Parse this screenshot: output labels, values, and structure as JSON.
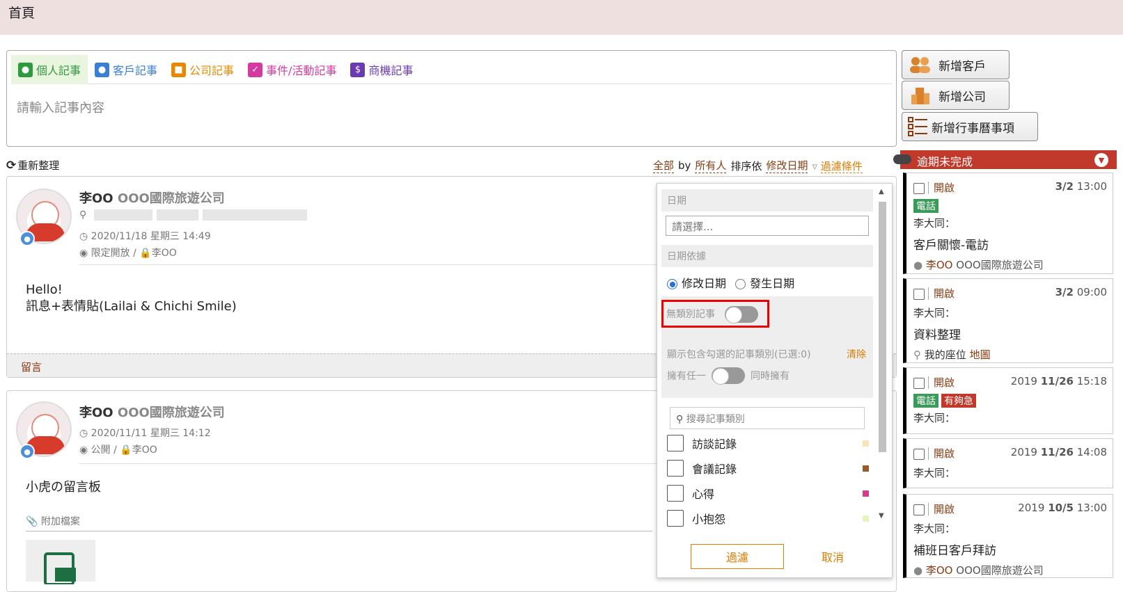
{
  "page": {
    "title": "首頁"
  },
  "composer": {
    "tabs": [
      {
        "label": "個人記事",
        "color": "#2e9a3e",
        "icon": "person-icon",
        "active": true
      },
      {
        "label": "客戶記事",
        "color": "#3a7fd5",
        "icon": "customer-icon"
      },
      {
        "label": "公司記事",
        "color": "#e58a00",
        "icon": "company-icon"
      },
      {
        "label": "事件/活動記事",
        "color": "#d63aa0",
        "icon": "calendar-icon"
      },
      {
        "label": "商機記事",
        "color": "#6a3ab0",
        "icon": "dollar-icon"
      }
    ],
    "placeholder": "請輸入記事內容"
  },
  "side_buttons": {
    "add_customer": "新增客戶",
    "add_company": "新增公司",
    "add_calendar": "新增行事曆事項"
  },
  "toolbar": {
    "refresh": "重新整理",
    "scope": "全部",
    "by": "by",
    "owner": "所有人",
    "sort_label": "排序依",
    "sort_field": "修改日期",
    "filter": "過濾條件"
  },
  "posts": [
    {
      "author": "李OO",
      "company": "OOO國際旅遊公司",
      "datetime": "2020/11/18 星期三 14:49",
      "visibility": "限定開放",
      "owner": "李OO",
      "content_line1": "Hello!",
      "content_line2": "訊息+表情貼(Lailai & Chichi Smile)",
      "comment": "留言"
    },
    {
      "author": "李OO",
      "company": "OOO國際旅遊公司",
      "datetime": "2020/11/11 星期三 14:12",
      "visibility": "公開",
      "owner": "李OO",
      "content_line1": "小虎の留言板",
      "attachment_label": "附加檔案"
    }
  ],
  "filter_panel": {
    "date_label": "日期",
    "date_placeholder": "請選擇...",
    "date_basis_label": "日期依據",
    "opt_modified": "修改日期",
    "opt_occurred": "發生日期",
    "no_category_label": "無類別記事",
    "include_label": "顯示包含勾選的記事類別(已選:0)",
    "clear": "清除",
    "any_label": "擁有任一",
    "all_label": "同時擁有",
    "search_placeholder": "搜尋記事類別",
    "categories": [
      {
        "label": "訪談記錄",
        "color": "#fbe5b8"
      },
      {
        "label": "會議記錄",
        "color": "#9a5a2a"
      },
      {
        "label": "心得",
        "color": "#d63a8a"
      },
      {
        "label": "小抱怨",
        "color": "#e5f5c0"
      }
    ],
    "apply": "過濾",
    "cancel": "取消"
  },
  "overdue": {
    "header": "逾期未完成",
    "cards": [
      {
        "status": "開啟",
        "date_bold": "3/2",
        "time": "13:00",
        "tags": [
          "電話"
        ],
        "with": "李大同：",
        "title": "客戶關懷-電訪",
        "person": "李OO",
        "org": "OOO國際旅遊公司"
      },
      {
        "status": "開啟",
        "date_bold": "3/2",
        "time": "09:00",
        "with": "李大同：",
        "title": "資料整理",
        "location": "我的座位",
        "map": "地圖"
      },
      {
        "status": "開啟",
        "year": "2019",
        "date_bold": "11/26",
        "time": "15:18",
        "tags": [
          "電話",
          "有夠急"
        ],
        "with": "李大同："
      },
      {
        "status": "開啟",
        "year": "2019",
        "date_bold": "11/26",
        "time": "14:08",
        "with": "李大同："
      },
      {
        "status": "開啟",
        "year": "2019",
        "date_bold": "10/5",
        "time": "13:00",
        "with": "李大同：",
        "title": "補班日客戶拜訪",
        "person": "李OO",
        "org": "OOO國際旅遊公司"
      }
    ]
  }
}
